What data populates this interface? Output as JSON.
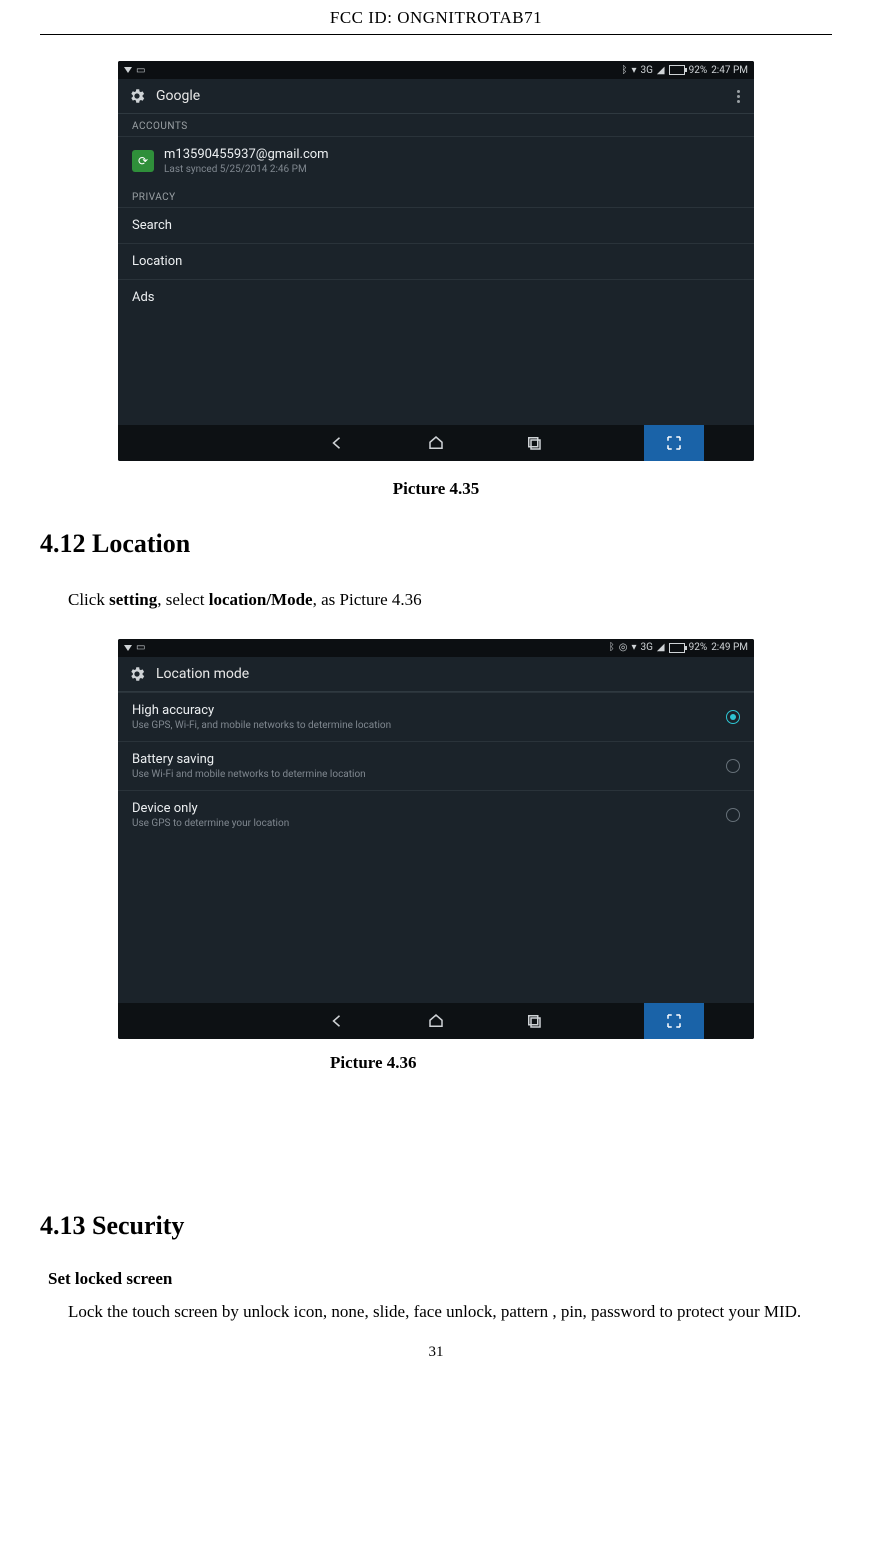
{
  "header": {
    "label": "FCC ID:",
    "value": "ONGNITROTAB71"
  },
  "page_number": "31",
  "fig435": {
    "caption": "Picture 4.35",
    "status": {
      "battery_pct": "92%",
      "time": "2:47 PM",
      "net": "3G"
    },
    "title": "Google",
    "sections": {
      "accounts_label": "ACCOUNTS",
      "account_email": "m13590455937@gmail.com",
      "account_sub": "Last synced 5/25/2014 2:46 PM",
      "privacy_label": "PRIVACY",
      "rows": {
        "search": "Search",
        "location": "Location",
        "ads": "Ads"
      }
    }
  },
  "sec412": {
    "heading": "4.12 Location",
    "body_pre": "Click ",
    "body_bold1": "setting",
    "body_mid": ", select ",
    "body_bold2": "location/Mode",
    "body_post": ", as Picture 4.36"
  },
  "fig436": {
    "caption": "Picture 4.36",
    "status": {
      "battery_pct": "92%",
      "time": "2:49 PM",
      "net": "3G"
    },
    "title": "Location mode",
    "rows": [
      {
        "title": "High accuracy",
        "sub": "Use GPS, Wi-Fi, and mobile networks to determine location",
        "selected": true
      },
      {
        "title": "Battery saving",
        "sub": "Use Wi-Fi and mobile networks to determine location",
        "selected": false
      },
      {
        "title": "Device only",
        "sub": "Use GPS to determine your location",
        "selected": false
      }
    ]
  },
  "sec413": {
    "heading": "4.13 Security",
    "sub": "Set locked screen",
    "body": "Lock the touch screen by unlock icon, none, slide, face unlock, pattern , pin, password to protect your MID."
  }
}
